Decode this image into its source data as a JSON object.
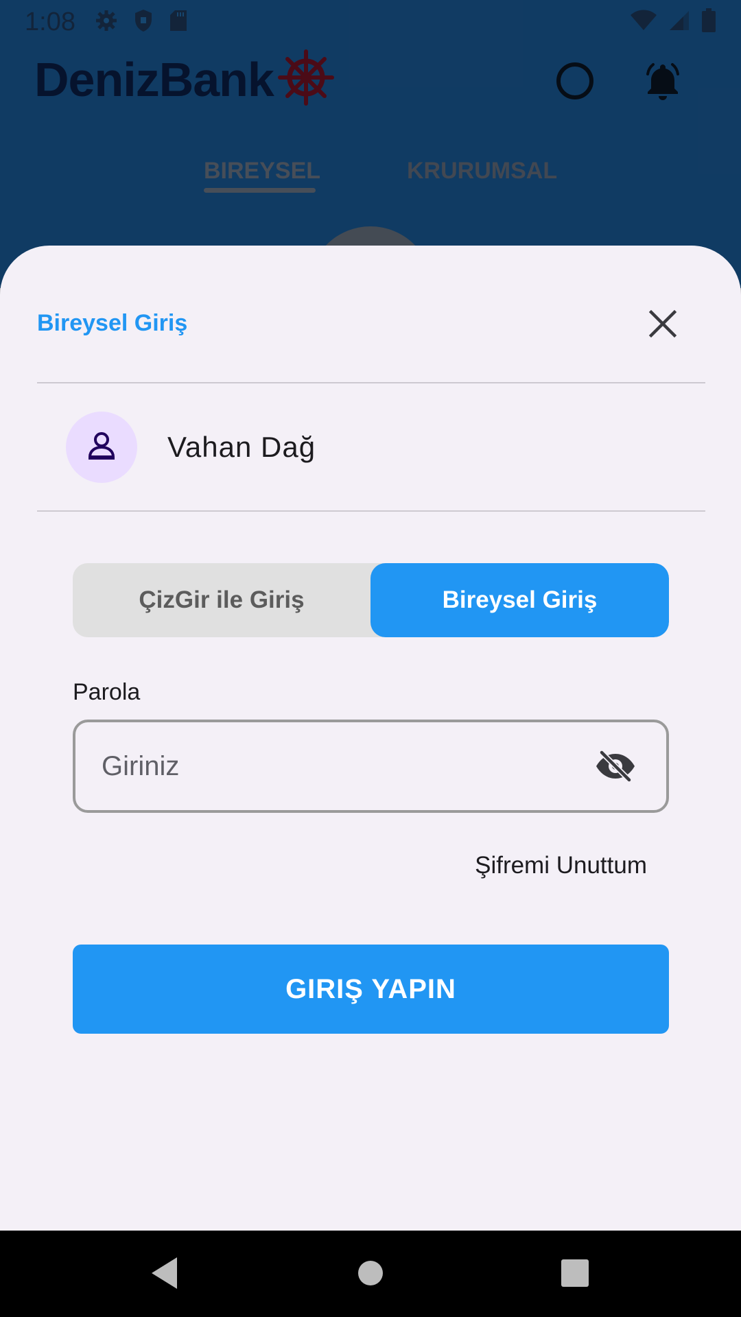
{
  "status_bar": {
    "time": "1:08",
    "left_icons": [
      "gear-icon",
      "shield-icon",
      "sd-card-icon"
    ],
    "right_icons": [
      "wifi-icon",
      "signal-icon",
      "battery-icon"
    ]
  },
  "header": {
    "brand": "DenizBank",
    "brand_color": "#0a1f4a",
    "wheel_color": "#7a1226",
    "tabs": [
      {
        "label": "BIREYSEL",
        "active": true
      },
      {
        "label": "KRURUMSAL",
        "active": false
      }
    ]
  },
  "sheet": {
    "title": "Bireysel Giriş",
    "user_name": "Vahan Dağ",
    "segmented": {
      "options": [
        "ÇizGir ile Giriş",
        "Bireysel Giriş"
      ],
      "selected": "Bireysel Giriş"
    },
    "password": {
      "label": "Parola",
      "placeholder": "Giriniz",
      "value": ""
    },
    "forgot_label": "Şifremi Unuttum",
    "submit_label": "GIRIŞ YAPIN",
    "accent_color": "#2196f3"
  }
}
